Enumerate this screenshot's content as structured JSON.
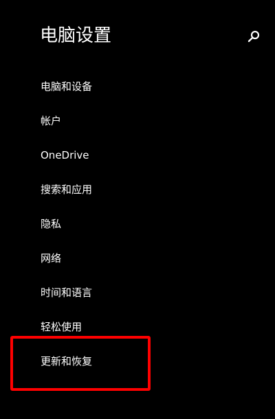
{
  "page": {
    "title": "电脑设置"
  },
  "search": {
    "icon": "search-icon"
  },
  "menu": {
    "items": [
      {
        "label": "电脑和设备"
      },
      {
        "label": "帐户"
      },
      {
        "label": "OneDrive"
      },
      {
        "label": "搜索和应用"
      },
      {
        "label": "隐私"
      },
      {
        "label": "网络"
      },
      {
        "label": "时间和语言"
      },
      {
        "label": "轻松使用"
      },
      {
        "label": "更新和恢复"
      }
    ]
  },
  "annotation": {
    "highlighted_item": "更新和恢复",
    "color": "#ff0000"
  },
  "colors": {
    "background": "#000000",
    "text": "#ffffff"
  }
}
